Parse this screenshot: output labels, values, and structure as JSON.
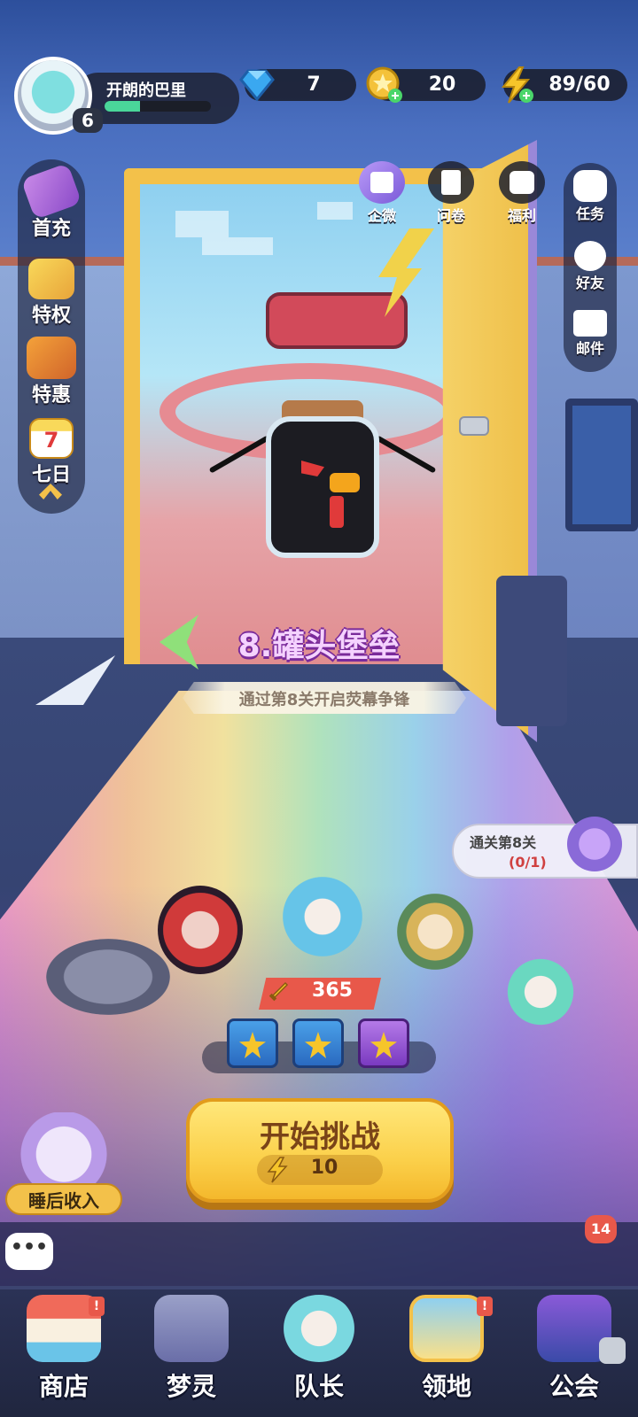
{
  "player": {
    "name": "开朗的巴里",
    "level": "6",
    "xp_fraction": 0.33
  },
  "currencies": {
    "gems": "7",
    "coins": "20",
    "energy": "89/60"
  },
  "left_menu": [
    {
      "label": "首充",
      "icon": "hammer-icon"
    },
    {
      "label": "特权",
      "icon": "privilege-cards-icon"
    },
    {
      "label": "特惠",
      "icon": "gift-box-icon"
    },
    {
      "label": "七日",
      "icon": "calendar-7-icon"
    }
  ],
  "top_menu": [
    {
      "label": "企微",
      "icon": "gift-icon"
    },
    {
      "label": "问卷",
      "icon": "survey-icon"
    },
    {
      "label": "福利",
      "icon": "welfare-icon"
    }
  ],
  "right_menu": [
    {
      "label": "任务",
      "icon": "task-icon"
    },
    {
      "label": "好友",
      "icon": "friends-icon"
    },
    {
      "label": "邮件",
      "icon": "mail-icon"
    }
  ],
  "stage": {
    "title": "8.罐头堡垒",
    "unlock_hint": "通过第8关开启荧幕争锋"
  },
  "quest": {
    "title": "通关第8关",
    "progress": "(0/1)"
  },
  "team": {
    "power": "365"
  },
  "start": {
    "label": "开始挑战",
    "cost": "10"
  },
  "idle_reward": {
    "label": "睡后收入"
  },
  "chat": {
    "bubble": "•••",
    "unread": "14"
  },
  "nav": [
    {
      "label": "商店",
      "badge": "!"
    },
    {
      "label": "梦灵",
      "badge": ""
    },
    {
      "label": "队长",
      "badge": ""
    },
    {
      "label": "领地",
      "badge": "!"
    },
    {
      "label": "公会",
      "badge": ""
    }
  ],
  "colors": {
    "accent_yellow": "#fbd04a",
    "badge_red": "#e8584a",
    "xp_green": "#4ad69a",
    "stage_title": "#f5d2ff"
  }
}
